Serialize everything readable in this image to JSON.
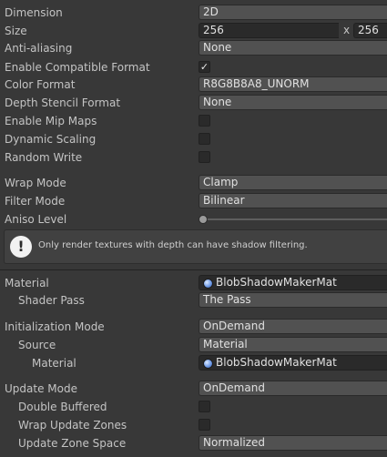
{
  "dimension": {
    "label": "Dimension",
    "value": "2D"
  },
  "size": {
    "label": "Size",
    "width": "256",
    "x_sep": "x",
    "height": "256"
  },
  "anti_aliasing": {
    "label": "Anti-aliasing",
    "value": "None"
  },
  "enable_compatible_format": {
    "label": "Enable Compatible Format",
    "checked": true,
    "check_glyph": "✓"
  },
  "color_format": {
    "label": "Color Format",
    "value": "R8G8B8A8_UNORM"
  },
  "depth_stencil_format": {
    "label": "Depth Stencil Format",
    "value": "None"
  },
  "enable_mip_maps": {
    "label": "Enable Mip Maps",
    "checked": false
  },
  "dynamic_scaling": {
    "label": "Dynamic Scaling",
    "checked": false
  },
  "random_write": {
    "label": "Random Write",
    "checked": false
  },
  "wrap_mode": {
    "label": "Wrap Mode",
    "value": "Clamp"
  },
  "filter_mode": {
    "label": "Filter Mode",
    "value": "Bilinear"
  },
  "aniso_level": {
    "label": "Aniso Level",
    "slider_fraction": 0
  },
  "help": {
    "icon": "!",
    "text": "Only render textures with depth can have shadow filtering."
  },
  "material": {
    "label": "Material",
    "value": "BlobShadowMakerMat",
    "icon": "material-sphere-icon"
  },
  "shader_pass": {
    "label": "Shader Pass",
    "value": "The Pass"
  },
  "initialization_mode": {
    "label": "Initialization Mode",
    "value": "OnDemand"
  },
  "source": {
    "label": "Source",
    "value": "Material"
  },
  "source_material": {
    "label": "Material",
    "value": "BlobShadowMakerMat",
    "icon": "material-sphere-icon"
  },
  "update_mode": {
    "label": "Update Mode",
    "value": "OnDemand"
  },
  "double_buffered": {
    "label": "Double Buffered",
    "checked": false
  },
  "wrap_update_zones": {
    "label": "Wrap Update Zones",
    "checked": false
  },
  "update_zone_space": {
    "label": "Update Zone Space",
    "value": "Normalized"
  },
  "colors": {
    "background": "#383838",
    "field": "#515151",
    "text_field": "#2a2a2a",
    "text": "#c4c4c4"
  }
}
